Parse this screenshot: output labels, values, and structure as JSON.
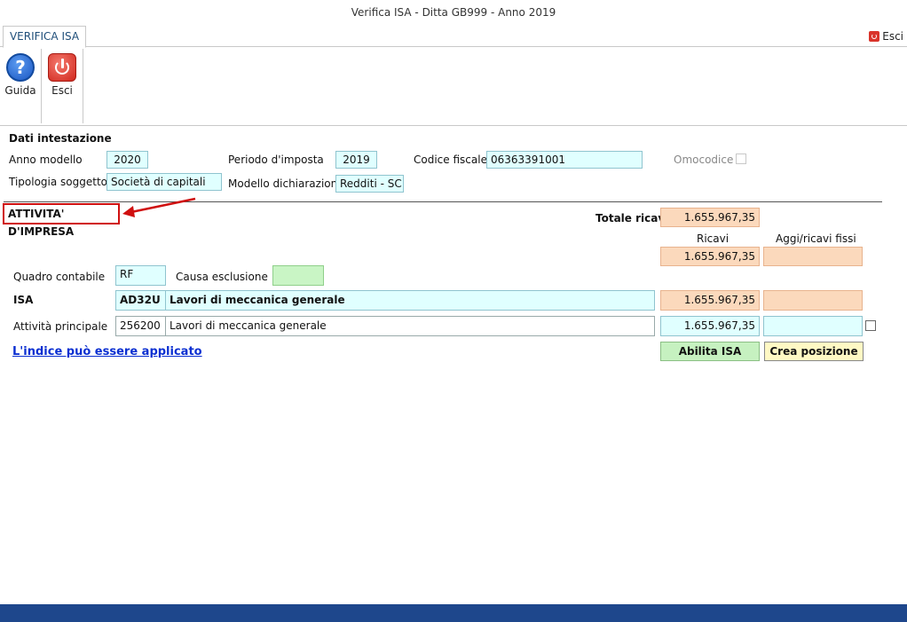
{
  "window": {
    "title": "Verifica ISA - Ditta GB999 - Anno 2019"
  },
  "tabs": {
    "active": "VERIFICA ISA",
    "exit_label": "Esci"
  },
  "ribbon": {
    "help_label": "Guida",
    "exit_label": "Esci"
  },
  "intestazione": {
    "heading": "Dati intestazione",
    "anno_modello_label": "Anno modello",
    "anno_modello": "2020",
    "periodo_label": "Periodo d'imposta",
    "periodo": "2019",
    "codice_fiscale_label": "Codice fiscale",
    "codice_fiscale": "06363391001",
    "omocodice_label": "Omocodice",
    "tipologia_label": "Tipologia soggetto",
    "tipologia": "Società di capitali",
    "modello_label": "Modello dichiarazione",
    "modello": "Redditi - SC"
  },
  "attivita": {
    "heading": "ATTIVITA' D'IMPRESA",
    "totale_ricavi_label": "Totale ricavi",
    "totale_ricavi": "1.655.967,35",
    "ricavi_header": "Ricavi",
    "aggi_header": "Aggi/ricavi fissi",
    "ricavi_summary": "1.655.967,35",
    "quadro_label": "Quadro contabile",
    "quadro": "RF",
    "causa_label": "Causa esclusione",
    "isa_label": "ISA",
    "isa_code": "AD32U",
    "isa_desc": "Lavori di meccanica generale",
    "isa_ricavi": "1.655.967,35",
    "principale_label": "Attività principale",
    "principale_code": "256200",
    "principale_desc": "Lavori di meccanica generale",
    "principale_ricavi": "1.655.967,35",
    "link_text": "L'indice può essere applicato",
    "abilita_btn": "Abilita ISA",
    "crea_btn": "Crea posizione"
  },
  "colors": {
    "accent": "#1e478c",
    "highlight": "#d01010",
    "peach": "#fbd9bc",
    "cyan": "#e0ffff"
  }
}
